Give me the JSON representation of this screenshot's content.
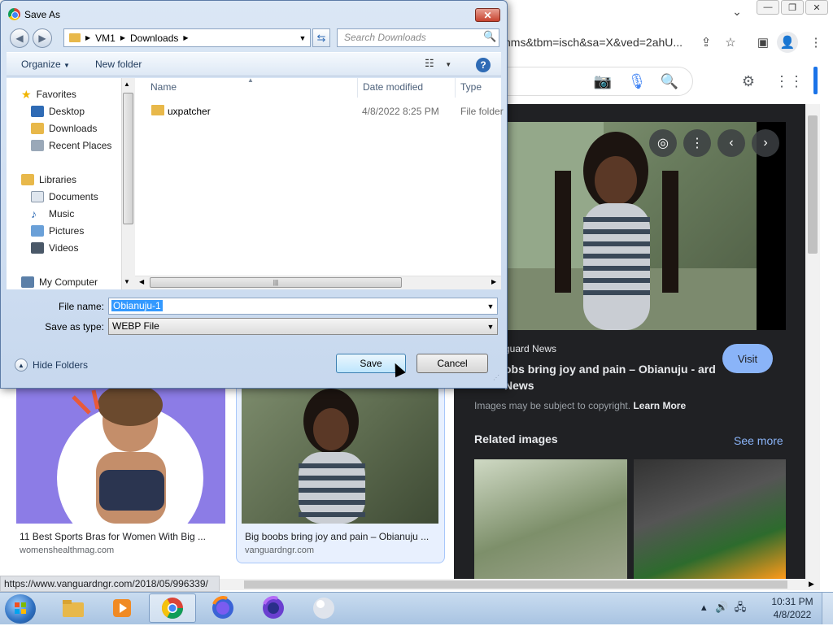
{
  "browser": {
    "omnibox_url": "hms&tbm=isch&sa=X&ved=2ahU...",
    "status_url": "https://www.vanguardngr.com/2018/05/996339/"
  },
  "detail_panel": {
    "source_name": "guard News",
    "title": "obs bring joy and pain – Obianuju - ard News",
    "visit_label": "Visit",
    "copyright_text": "Images may be subject to copyright.",
    "learn_more": "Learn More",
    "related_heading": "Related images",
    "see_more": "See more"
  },
  "results": [
    {
      "title": "11 Best Sports Bras for Women With Big ...",
      "site": "womenshealthmag.com"
    },
    {
      "title": "Big boobs bring joy and pain – Obianuju ...",
      "site": "vanguardngr.com"
    }
  ],
  "taskbar": {
    "time": "10:31 PM",
    "date": "4/8/2022"
  },
  "dialog": {
    "title": "Save As",
    "breadcrumb": [
      "VM1",
      "Downloads"
    ],
    "search_placeholder": "Search Downloads",
    "organize_label": "Organize",
    "new_folder_label": "New folder",
    "nav_items": [
      {
        "label": "Favorites",
        "icon": "star-icon",
        "indent": 0
      },
      {
        "label": "Desktop",
        "icon": "desktop-icon",
        "indent": 1
      },
      {
        "label": "Downloads",
        "icon": "downloads-folder-icon",
        "indent": 1
      },
      {
        "label": "Recent Places",
        "icon": "recent-places-icon",
        "indent": 1
      },
      {
        "label": "Libraries",
        "icon": "libraries-icon",
        "indent": 0
      },
      {
        "label": "Documents",
        "icon": "documents-icon",
        "indent": 1
      },
      {
        "label": "Music",
        "icon": "music-icon",
        "indent": 1
      },
      {
        "label": "Pictures",
        "icon": "pictures-icon",
        "indent": 1
      },
      {
        "label": "Videos",
        "icon": "videos-icon",
        "indent": 1
      },
      {
        "label": "My Computer",
        "icon": "computer-icon",
        "indent": 0
      }
    ],
    "columns": {
      "name": "Name",
      "date_modified": "Date modified",
      "type": "Type"
    },
    "files": [
      {
        "name": "uxpatcher",
        "date_modified": "4/8/2022 8:25 PM",
        "type": "File folder"
      }
    ],
    "file_name_label": "File name:",
    "file_name_value": "Obianuju-1",
    "save_type_label": "Save as type:",
    "save_type_value": "WEBP File",
    "hide_folders_label": "Hide Folders",
    "save_label": "Save",
    "cancel_label": "Cancel"
  }
}
